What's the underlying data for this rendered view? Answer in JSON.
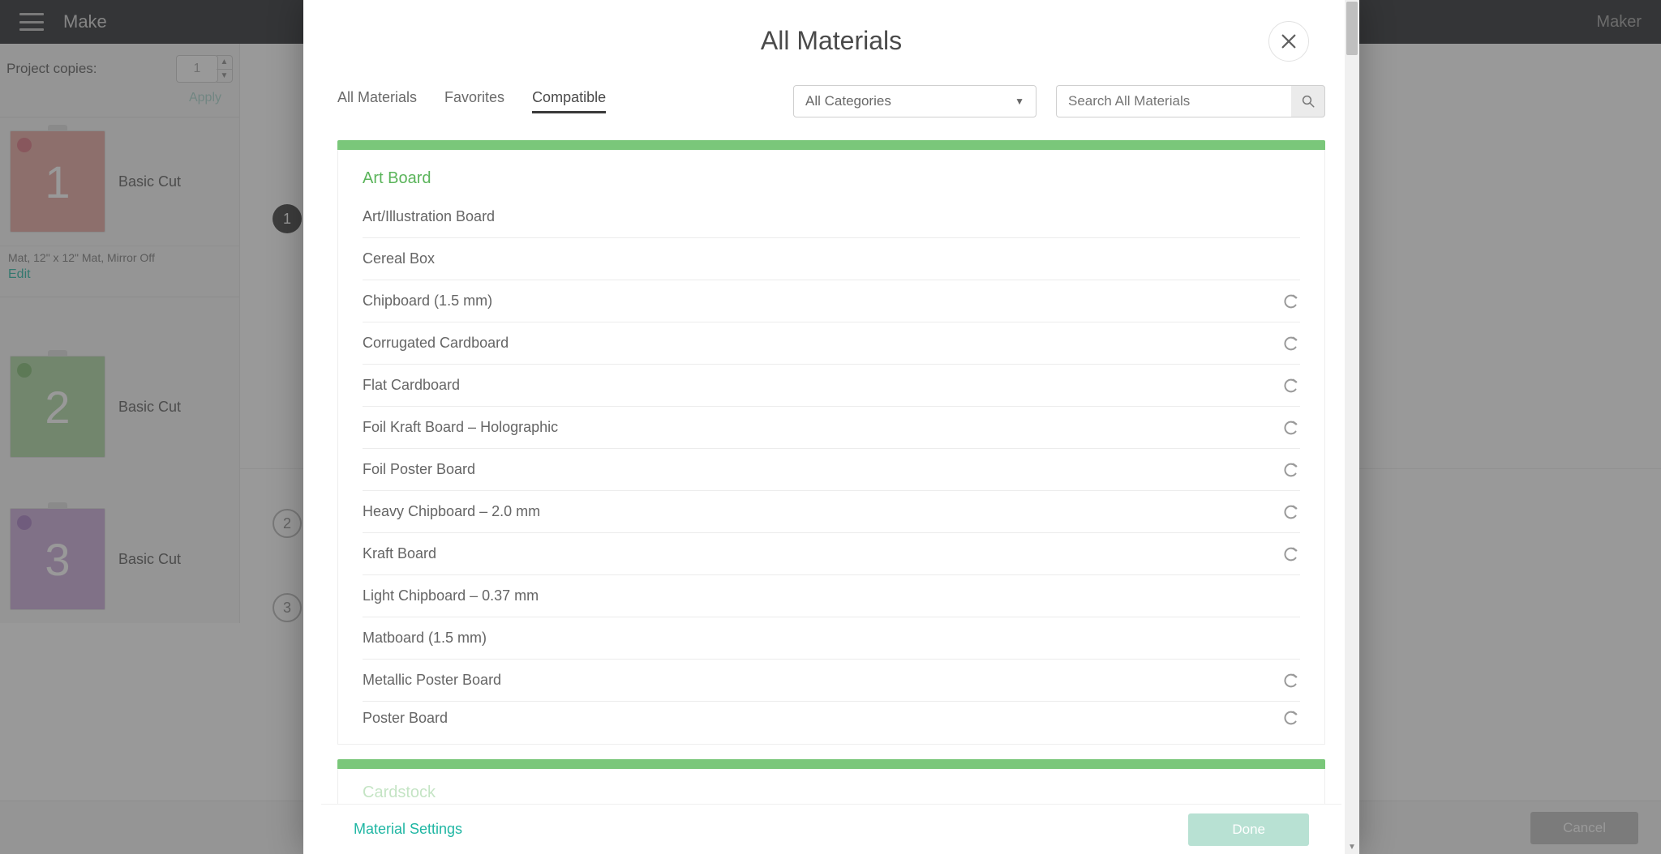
{
  "colors": {
    "teal": "#1fb6a3",
    "green": "#7ac77a"
  },
  "header": {
    "make": "Make",
    "maker": "Maker"
  },
  "project": {
    "copies_label": "Project copies:",
    "copies_value": "1",
    "apply": "Apply"
  },
  "mats": [
    {
      "num": "1",
      "label": "Basic Cut",
      "meta": "Mat, 12\" x 12\" Mat, Mirror Off",
      "edit": "Edit",
      "color": "pink",
      "icon": "heart"
    },
    {
      "num": "2",
      "label": "Basic Cut",
      "color": "green",
      "icon": "plus"
    },
    {
      "num": "3",
      "label": "Basic Cut",
      "color": "purple",
      "icon": "peace"
    }
  ],
  "steps": [
    "1",
    "2",
    "3"
  ],
  "footer": {
    "cancel": "Cancel"
  },
  "modal": {
    "title": "All Materials",
    "tabs": {
      "all": "All Materials",
      "fav": "Favorites",
      "compat": "Compatible"
    },
    "category_select": "All Categories",
    "search_placeholder": "Search All Materials",
    "material_settings": "Material Settings",
    "done": "Done",
    "categories": [
      {
        "name": "Art Board",
        "color": "green",
        "items": [
          {
            "name": "Art/Illustration Board",
            "badge": false
          },
          {
            "name": "Cereal Box",
            "badge": false
          },
          {
            "name": "Chipboard (1.5 mm)",
            "badge": true
          },
          {
            "name": "Corrugated Cardboard",
            "badge": true
          },
          {
            "name": "Flat Cardboard",
            "badge": true
          },
          {
            "name": "Foil Kraft Board  – Holographic",
            "badge": true
          },
          {
            "name": "Foil Poster Board",
            "badge": true
          },
          {
            "name": "Heavy Chipboard – 2.0 mm",
            "badge": true
          },
          {
            "name": "Kraft Board",
            "badge": true
          },
          {
            "name": "Light Chipboard – 0.37 mm",
            "badge": false
          },
          {
            "name": "Matboard (1.5 mm)",
            "badge": false
          },
          {
            "name": "Metallic Poster Board",
            "badge": true
          },
          {
            "name": "Poster Board",
            "badge": true
          }
        ]
      }
    ],
    "next_category_hint": "Cardstock"
  }
}
